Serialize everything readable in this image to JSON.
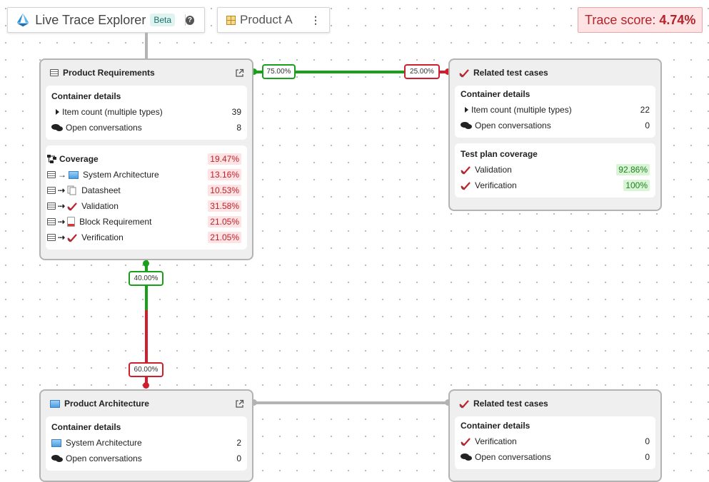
{
  "toolbar": {
    "app_title": "Live Trace Explorer",
    "beta_label": "Beta",
    "help_label": "?",
    "product_name": "Product A",
    "menu_label": "⋮"
  },
  "trace_score": {
    "label": "Trace score:",
    "value": "4.74%"
  },
  "connectors": {
    "req_to_tests_covered": "75.00%",
    "req_to_tests_uncovered": "25.00%",
    "req_to_arch_covered": "40.00%",
    "req_to_arch_uncovered": "60.00%"
  },
  "colors": {
    "covered": "#19a019",
    "uncovered": "#cf1f2f",
    "neutral": "#b3b3b3"
  },
  "product_requirements": {
    "title": "Product Requirements",
    "details_title": "Container details",
    "item_count_label": "Item count (multiple types)",
    "item_count": "39",
    "conversations_label": "Open conversations",
    "conversations": "8",
    "coverage_title": "Coverage",
    "coverage_total": "19.47%",
    "coverage": [
      {
        "label": "System Architecture",
        "value": "13.16%",
        "icon": "system-architecture-icon"
      },
      {
        "label": "Datasheet",
        "value": "10.53%",
        "icon": "datasheet-icon"
      },
      {
        "label": "Validation",
        "value": "31.58%",
        "icon": "test-check-icon"
      },
      {
        "label": "Block Requirement",
        "value": "21.05%",
        "icon": "block-requirement-icon"
      },
      {
        "label": "Verification",
        "value": "21.05%",
        "icon": "test-check-icon"
      }
    ]
  },
  "related_tests_top": {
    "title": "Related test cases",
    "details_title": "Container details",
    "item_count_label": "Item count (multiple types)",
    "item_count": "22",
    "conversations_label": "Open conversations",
    "conversations": "0",
    "coverage_title": "Test plan coverage",
    "coverage": [
      {
        "label": "Validation",
        "value": "92.86%"
      },
      {
        "label": "Verification",
        "value": "100%"
      }
    ]
  },
  "product_architecture": {
    "title": "Product Architecture",
    "details_title": "Container details",
    "rows": [
      {
        "label": "System Architecture",
        "value": "2"
      },
      {
        "label": "Open conversations",
        "value": "0"
      }
    ]
  },
  "related_tests_bottom": {
    "title": "Related test cases",
    "details_title": "Container details",
    "rows": [
      {
        "label": "Verification",
        "value": "0"
      },
      {
        "label": "Open conversations",
        "value": "0"
      }
    ]
  }
}
